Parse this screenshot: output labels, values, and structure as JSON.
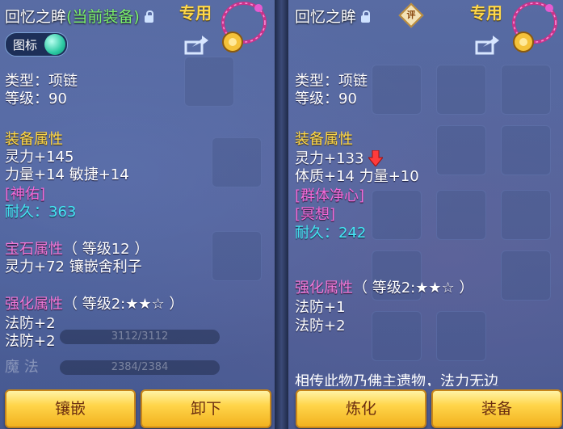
{
  "left": {
    "title": "回忆之眸",
    "title_status": "(当前装备)",
    "exclusive_tag": "专用",
    "icon_toggle_label": "图标",
    "type_line": "类型：项链",
    "level_line": "等级：90",
    "equip_attr_header": "装备属性",
    "attr_lines": [
      "灵力+145",
      "力量+14 敏捷+14"
    ],
    "effect": "[神佑]",
    "durability_label": "耐久：",
    "durability_value": "363",
    "gem_header": "宝石属性",
    "gem_level": "（ 等级12 ）",
    "gem_line": "灵力+72 镶嵌舍利子",
    "enhance_header": "强化属性",
    "enhance_level": "（ 等级2:★★☆ ）",
    "enhance_lines": [
      "法防+2",
      "法防+2"
    ],
    "bg_bar_1": "3112/3112",
    "bg_bar_2": "2384/2384",
    "bg_label": "魔 法",
    "button_inlay": "镶嵌",
    "button_unequip": "卸下"
  },
  "right": {
    "title": "回忆之眸",
    "eval_badge": "评",
    "exclusive_tag": "专用",
    "type_line": "类型：项链",
    "level_line": "等级：90",
    "equip_attr_header": "装备属性",
    "attr_lines": [
      "灵力+133",
      "体质+14 力量+10"
    ],
    "effects": [
      "[群体净心]",
      "[冥想]"
    ],
    "durability_label": "耐久：",
    "durability_value": "242",
    "enhance_header": "强化属性",
    "enhance_level": "（ 等级2:★★☆ ）",
    "enhance_lines": [
      "法防+1",
      "法防+2"
    ],
    "description_cut": "相传此物乃佛主遗物，法力无边",
    "button_refine": "炼化",
    "button_equip": "装备"
  },
  "colors": {
    "yellow": "#ffd84a",
    "magenta": "#f36bd8",
    "cyan": "#46e7f6",
    "green": "#7cf26a",
    "button": "#ffd54a"
  },
  "icons": [
    "lock-icon",
    "necklace-item-icon",
    "share-icon",
    "down-arrow-icon",
    "evaluate-icon"
  ]
}
